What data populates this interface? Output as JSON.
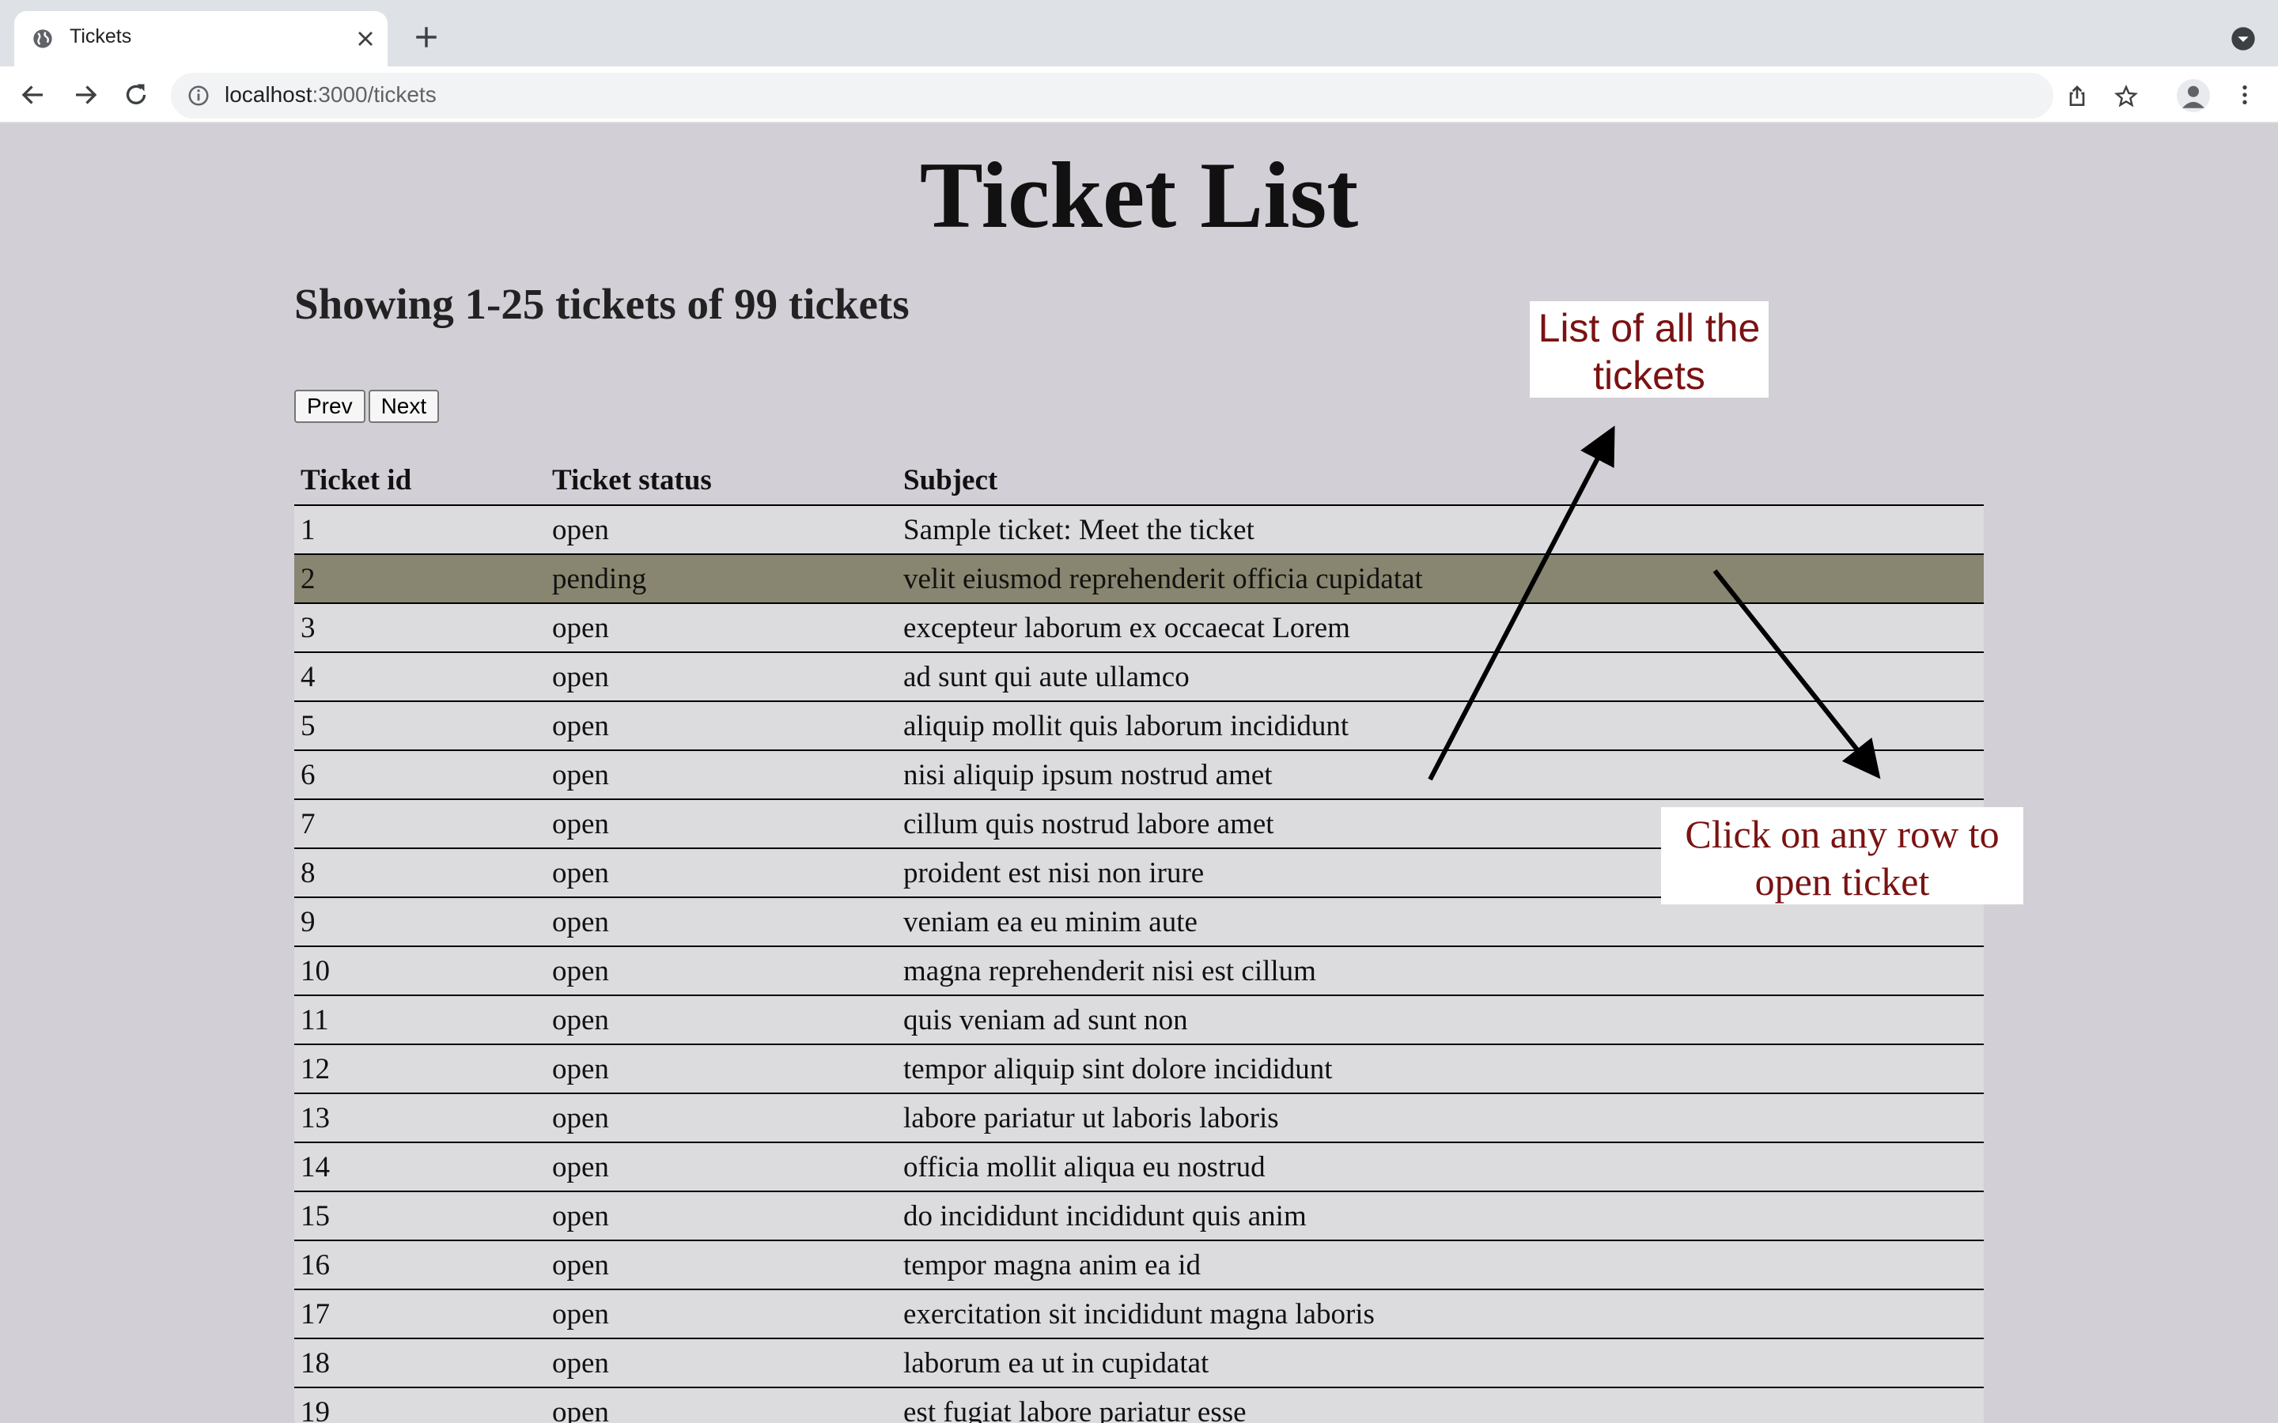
{
  "browser": {
    "tab_title": "Tickets",
    "url_host": "localhost",
    "url_path": ":3000/tickets"
  },
  "page": {
    "title": "Ticket List",
    "showing_text": "Showing 1-25 tickets of 99 tickets",
    "prev_label": "Prev",
    "next_label": "Next"
  },
  "table": {
    "headers": [
      "Ticket id",
      "Ticket status",
      "Subject"
    ],
    "rows": [
      {
        "id": "1",
        "status": "open",
        "subject": "Sample ticket: Meet the ticket"
      },
      {
        "id": "2",
        "status": "pending",
        "subject": "velit eiusmod reprehenderit officia cupidatat",
        "selected": true
      },
      {
        "id": "3",
        "status": "open",
        "subject": "excepteur laborum ex occaecat Lorem"
      },
      {
        "id": "4",
        "status": "open",
        "subject": "ad sunt qui aute ullamco"
      },
      {
        "id": "5",
        "status": "open",
        "subject": "aliquip mollit quis laborum incididunt"
      },
      {
        "id": "6",
        "status": "open",
        "subject": "nisi aliquip ipsum nostrud amet"
      },
      {
        "id": "7",
        "status": "open",
        "subject": "cillum quis nostrud labore amet"
      },
      {
        "id": "8",
        "status": "open",
        "subject": "proident est nisi non irure"
      },
      {
        "id": "9",
        "status": "open",
        "subject": "veniam ea eu minim aute"
      },
      {
        "id": "10",
        "status": "open",
        "subject": "magna reprehenderit nisi est cillum"
      },
      {
        "id": "11",
        "status": "open",
        "subject": "quis veniam ad sunt non"
      },
      {
        "id": "12",
        "status": "open",
        "subject": "tempor aliquip sint dolore incididunt"
      },
      {
        "id": "13",
        "status": "open",
        "subject": "labore pariatur ut laboris laboris"
      },
      {
        "id": "14",
        "status": "open",
        "subject": "officia mollit aliqua eu nostrud"
      },
      {
        "id": "15",
        "status": "open",
        "subject": "do incididunt incididunt quis anim"
      },
      {
        "id": "16",
        "status": "open",
        "subject": "tempor magna anim ea id"
      },
      {
        "id": "17",
        "status": "open",
        "subject": "exercitation sit incididunt magna laboris"
      },
      {
        "id": "18",
        "status": "open",
        "subject": "laborum ea ut in cupidatat"
      },
      {
        "id": "19",
        "status": "open",
        "subject": "est fugiat labore pariatur esse"
      }
    ]
  },
  "annotations": {
    "list_callout": "List of all the tickets",
    "click_callout": "Click on any row to open ticket"
  },
  "colors": {
    "page_bg": "#d2cfd6",
    "row_bg": "#dcdbde",
    "selected_row_bg": "#888670",
    "callout_text": "#7a1212"
  }
}
